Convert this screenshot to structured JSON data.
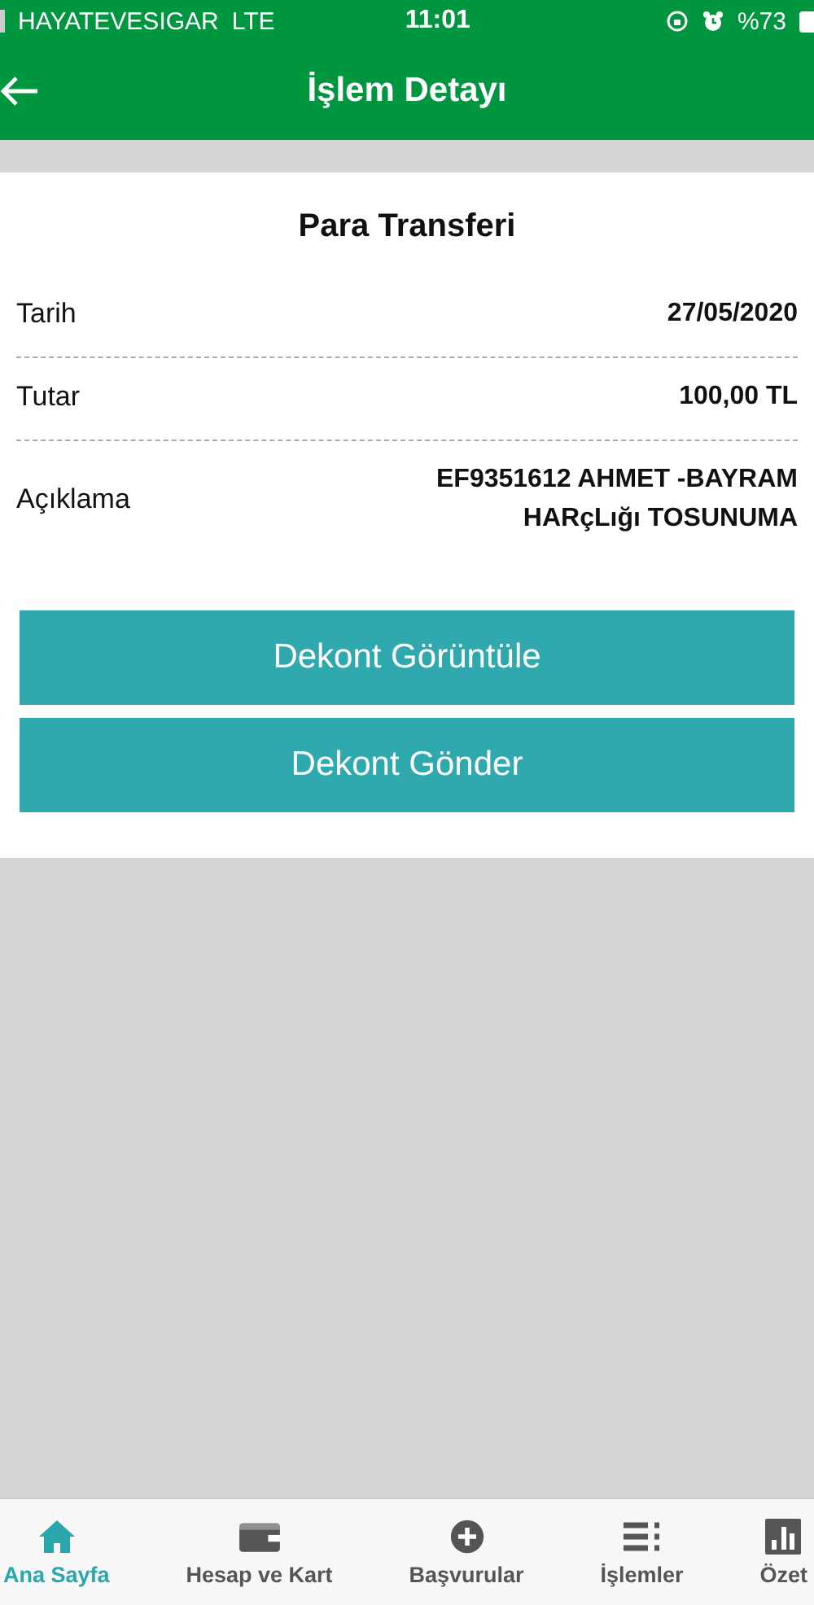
{
  "status_bar": {
    "carrier": "HAYATEVESIGAR",
    "network": "LTE",
    "time": "11:01",
    "battery": "%73"
  },
  "header": {
    "title": "İşlem Detayı"
  },
  "card": {
    "title": "Para Transferi",
    "rows": [
      {
        "label": "Tarih",
        "value": "27/05/2020"
      },
      {
        "label": "Tutar",
        "value": "100,00 TL"
      },
      {
        "label": "Açıklama",
        "value_lines": [
          "EF9351612 AHMET -BAYRAM",
          "HARçLığı TOSUNUMA"
        ]
      }
    ],
    "buttons": [
      "Dekont Görüntüle",
      "Dekont Gönder"
    ]
  },
  "tab_bar": [
    {
      "label": "Ana Sayfa",
      "kind": "home",
      "selected": true
    },
    {
      "label": "Hesap ve Kart",
      "kind": "wallet",
      "selected": false
    },
    {
      "label": "Başvurular",
      "kind": "plus",
      "selected": false
    },
    {
      "label": "İşlemler",
      "kind": "list",
      "selected": false
    },
    {
      "label": "Özet",
      "kind": "chart",
      "selected": false
    }
  ]
}
